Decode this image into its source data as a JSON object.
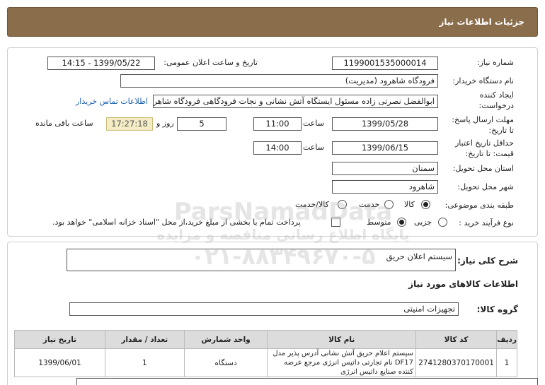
{
  "header": {
    "title": "جزئیات اطلاعات نیاز"
  },
  "form": {
    "need_number_label": "شماره نیاز:",
    "need_number": "1199001535000014",
    "announce_label": "تاریخ و ساعت اعلان عمومی:",
    "announce_value": "1399/05/22 - 14:15",
    "buyer_label": "نام دستگاه خریدار:",
    "buyer_value": "فرودگاه شاهرود (مدیریت)",
    "creator_label_1": "ایجاد کننده",
    "creator_label_2": "درخواست:",
    "creator_value": "ابوالفضل نصرتی زاده مسئول ایستگاه آتش نشانی و نجات فرودگاهی فرودگاه شاهرود",
    "contact_link": "اطلاعات تماس خریدار",
    "deadline_label_1": "مهلت ارسال پاسخ:",
    "deadline_label_2": "تا تاریخ:",
    "deadline_date": "1399/05/28",
    "time_label": "ساعت",
    "deadline_time": "11:00",
    "days_value": "5",
    "days_label": "روز و",
    "remaining_time": "17:27:18",
    "remaining_label": "ساعت باقی مانده",
    "validity_label_1": "حداقل تاریخ اعتبار",
    "validity_label_2": "قیمت: تا تاریخ:",
    "validity_date": "1399/06/15",
    "validity_time": "14:00",
    "province_label": "استان محل تحویل:",
    "province_value": "سمنان",
    "city_label": "شهر محل تحویل:",
    "city_value": "شاهرود",
    "category_label": "طبقه بندی موضوعی:",
    "category_options": [
      "کالا",
      "خدمت",
      "کالا/خدمت"
    ],
    "process_label": "نوع فرآیند خرید :",
    "process_options": [
      "جزیی",
      "متوسط"
    ],
    "payment_note": "پرداخت تمام یا بخشی از مبلغ خرید،از محل \"اسناد خزانه اسلامی\" خواهد بود."
  },
  "summary": {
    "desc_label": "شرح کلی نیاز:",
    "desc_value": "سیستم اعلان حریق",
    "goods_title": "اطلاعات کالاهای مورد نیاز",
    "group_label": "گروه کالا:",
    "group_value": "تجهیزات امنیتی"
  },
  "table": {
    "headers": [
      "ردیف",
      "کد کالا",
      "نام کالا",
      "واحد شمارش",
      "تعداد / مقدار",
      "تاریخ نیاز"
    ],
    "rows": [
      {
        "row": "1",
        "code": "2741280370170001",
        "name": "سیستم اعلام حریق آتش نشانی آدرس پذیر مدل DF17 نام تجارتی داتیس انرژی مرجع عرضه کننده صنایع داتیس انرژی",
        "unit": "دستگاه",
        "qty": "1",
        "date": "1399/06/01"
      }
    ]
  },
  "watermark": {
    "line1": "ParsNamadData",
    "line2": "پایگاه اطلاع رسانی مناقصه و مزایده",
    "line3": "۰۲۱-۸۸۳۴۹۶۷۰-۵"
  }
}
